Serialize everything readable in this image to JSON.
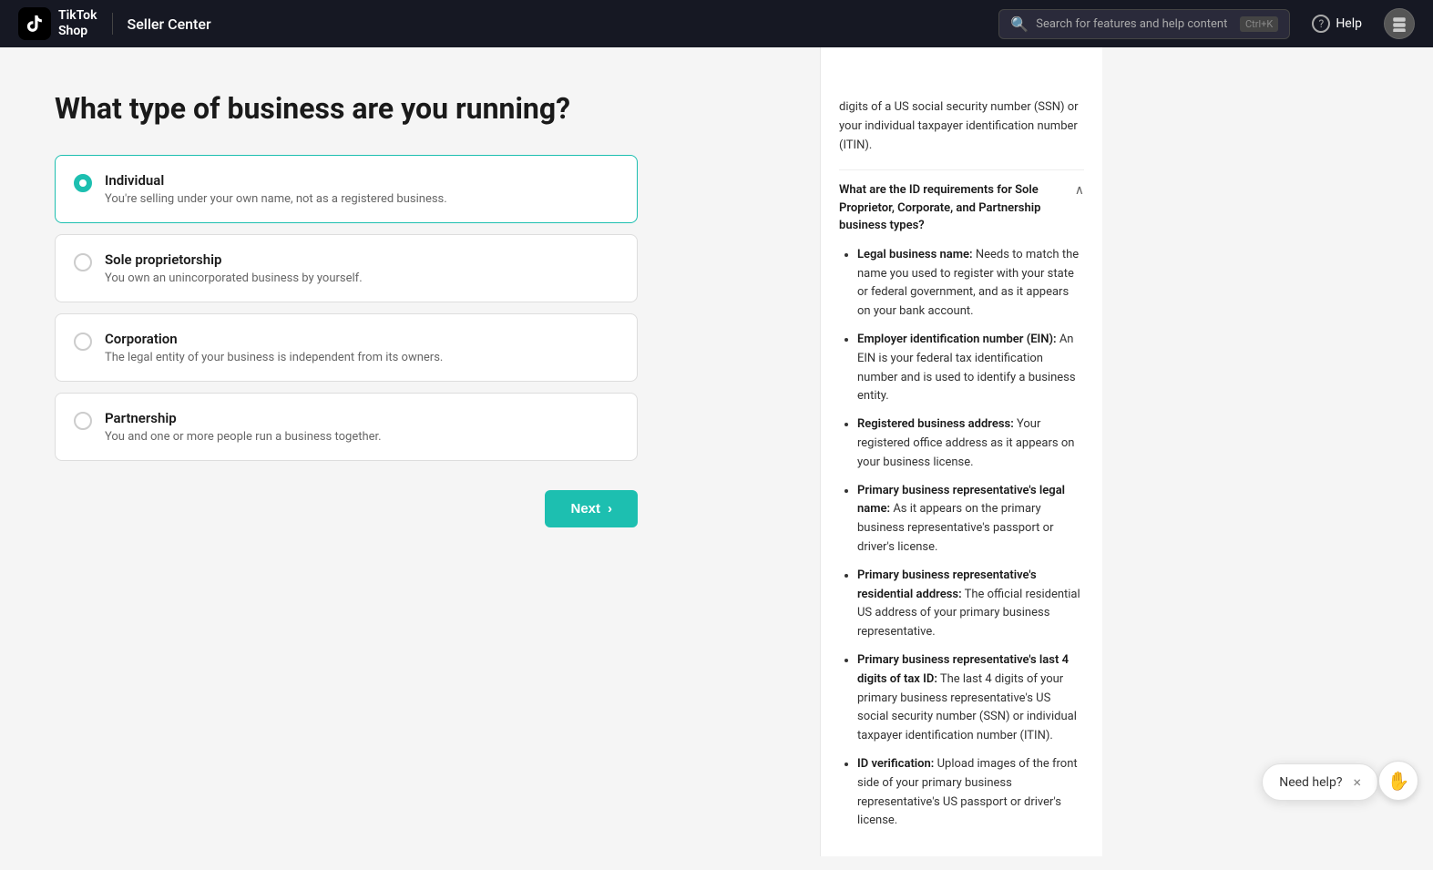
{
  "header": {
    "logo_top": "TikTok",
    "logo_bottom": "Shop",
    "seller_center": "Seller Center",
    "search_placeholder": "Search for features and help content",
    "search_shortcut": "Ctrl+K",
    "help_label": "Help",
    "search_icon": "🔍",
    "help_icon": "?"
  },
  "page": {
    "title": "What type of business are you running?",
    "options": [
      {
        "id": "individual",
        "name": "Individual",
        "desc": "You're selling under your own name, not as a registered business.",
        "selected": true
      },
      {
        "id": "sole-proprietorship",
        "name": "Sole proprietorship",
        "desc": "You own an unincorporated business by yourself.",
        "selected": false
      },
      {
        "id": "corporation",
        "name": "Corporation",
        "desc": "The legal entity of your business is independent from its owners.",
        "selected": false
      },
      {
        "id": "partnership",
        "name": "Partnership",
        "desc": "You and one or more people run a business together.",
        "selected": false
      }
    ],
    "next_button": "Next"
  },
  "right_panel": {
    "partial_text": "digits of a US social security number (SSN) or your individual taxpayer identification number (ITIN).",
    "section": {
      "title": "What are the ID requirements for Sole Proprietor, Corporate, and Partnership business types?",
      "expanded": true,
      "items": [
        {
          "label": "Legal business name:",
          "text": "Needs to match the name you used to register with your state or federal government, and as it appears on your bank account."
        },
        {
          "label": "Employer identification number (EIN):",
          "text": "An EIN is your federal tax identification number and is used to identify a business entity."
        },
        {
          "label": "Registered business address:",
          "text": "Your registered office address as it appears on your business license."
        },
        {
          "label": "Primary business representative's legal name:",
          "text": "As it appears on the primary business representative's passport or driver's license."
        },
        {
          "label": "Primary business representative's residential address:",
          "text": "The official residential US address of your primary business representative."
        },
        {
          "label": "Primary business representative's last 4 digits of tax ID:",
          "text": "The last 4 digits of your primary business representative's US social security number (SSN) or individual taxpayer identification number (ITIN)."
        },
        {
          "label": "ID verification:",
          "text": "Upload images of the front side of your primary business representative's US passport or driver's license."
        }
      ]
    }
  },
  "need_help": {
    "label": "Need help?",
    "close": "×"
  }
}
